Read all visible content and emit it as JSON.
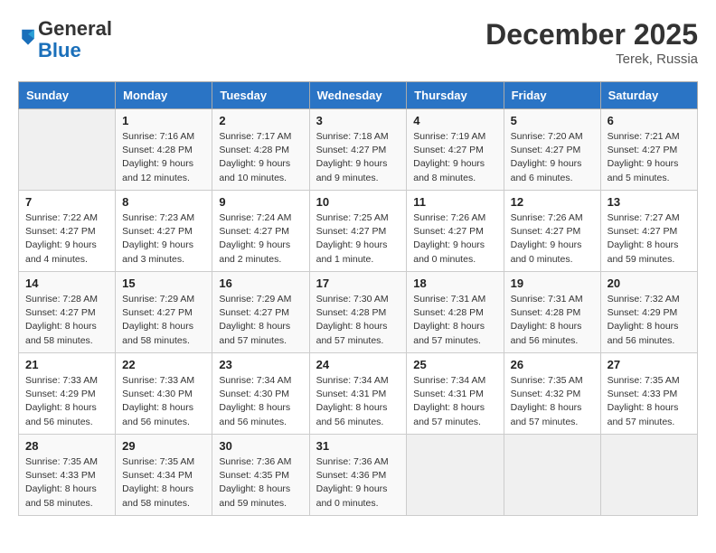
{
  "header": {
    "logo_general": "General",
    "logo_blue": "Blue",
    "month_title": "December 2025",
    "location": "Terek, Russia"
  },
  "days_of_week": [
    "Sunday",
    "Monday",
    "Tuesday",
    "Wednesday",
    "Thursday",
    "Friday",
    "Saturday"
  ],
  "weeks": [
    [
      {
        "day": "",
        "detail": ""
      },
      {
        "day": "1",
        "detail": "Sunrise: 7:16 AM\nSunset: 4:28 PM\nDaylight: 9 hours\nand 12 minutes."
      },
      {
        "day": "2",
        "detail": "Sunrise: 7:17 AM\nSunset: 4:28 PM\nDaylight: 9 hours\nand 10 minutes."
      },
      {
        "day": "3",
        "detail": "Sunrise: 7:18 AM\nSunset: 4:27 PM\nDaylight: 9 hours\nand 9 minutes."
      },
      {
        "day": "4",
        "detail": "Sunrise: 7:19 AM\nSunset: 4:27 PM\nDaylight: 9 hours\nand 8 minutes."
      },
      {
        "day": "5",
        "detail": "Sunrise: 7:20 AM\nSunset: 4:27 PM\nDaylight: 9 hours\nand 6 minutes."
      },
      {
        "day": "6",
        "detail": "Sunrise: 7:21 AM\nSunset: 4:27 PM\nDaylight: 9 hours\nand 5 minutes."
      }
    ],
    [
      {
        "day": "7",
        "detail": "Sunrise: 7:22 AM\nSunset: 4:27 PM\nDaylight: 9 hours\nand 4 minutes."
      },
      {
        "day": "8",
        "detail": "Sunrise: 7:23 AM\nSunset: 4:27 PM\nDaylight: 9 hours\nand 3 minutes."
      },
      {
        "day": "9",
        "detail": "Sunrise: 7:24 AM\nSunset: 4:27 PM\nDaylight: 9 hours\nand 2 minutes."
      },
      {
        "day": "10",
        "detail": "Sunrise: 7:25 AM\nSunset: 4:27 PM\nDaylight: 9 hours\nand 1 minute."
      },
      {
        "day": "11",
        "detail": "Sunrise: 7:26 AM\nSunset: 4:27 PM\nDaylight: 9 hours\nand 0 minutes."
      },
      {
        "day": "12",
        "detail": "Sunrise: 7:26 AM\nSunset: 4:27 PM\nDaylight: 9 hours\nand 0 minutes."
      },
      {
        "day": "13",
        "detail": "Sunrise: 7:27 AM\nSunset: 4:27 PM\nDaylight: 8 hours\nand 59 minutes."
      }
    ],
    [
      {
        "day": "14",
        "detail": "Sunrise: 7:28 AM\nSunset: 4:27 PM\nDaylight: 8 hours\nand 58 minutes."
      },
      {
        "day": "15",
        "detail": "Sunrise: 7:29 AM\nSunset: 4:27 PM\nDaylight: 8 hours\nand 58 minutes."
      },
      {
        "day": "16",
        "detail": "Sunrise: 7:29 AM\nSunset: 4:27 PM\nDaylight: 8 hours\nand 57 minutes."
      },
      {
        "day": "17",
        "detail": "Sunrise: 7:30 AM\nSunset: 4:28 PM\nDaylight: 8 hours\nand 57 minutes."
      },
      {
        "day": "18",
        "detail": "Sunrise: 7:31 AM\nSunset: 4:28 PM\nDaylight: 8 hours\nand 57 minutes."
      },
      {
        "day": "19",
        "detail": "Sunrise: 7:31 AM\nSunset: 4:28 PM\nDaylight: 8 hours\nand 56 minutes."
      },
      {
        "day": "20",
        "detail": "Sunrise: 7:32 AM\nSunset: 4:29 PM\nDaylight: 8 hours\nand 56 minutes."
      }
    ],
    [
      {
        "day": "21",
        "detail": "Sunrise: 7:33 AM\nSunset: 4:29 PM\nDaylight: 8 hours\nand 56 minutes."
      },
      {
        "day": "22",
        "detail": "Sunrise: 7:33 AM\nSunset: 4:30 PM\nDaylight: 8 hours\nand 56 minutes."
      },
      {
        "day": "23",
        "detail": "Sunrise: 7:34 AM\nSunset: 4:30 PM\nDaylight: 8 hours\nand 56 minutes."
      },
      {
        "day": "24",
        "detail": "Sunrise: 7:34 AM\nSunset: 4:31 PM\nDaylight: 8 hours\nand 56 minutes."
      },
      {
        "day": "25",
        "detail": "Sunrise: 7:34 AM\nSunset: 4:31 PM\nDaylight: 8 hours\nand 57 minutes."
      },
      {
        "day": "26",
        "detail": "Sunrise: 7:35 AM\nSunset: 4:32 PM\nDaylight: 8 hours\nand 57 minutes."
      },
      {
        "day": "27",
        "detail": "Sunrise: 7:35 AM\nSunset: 4:33 PM\nDaylight: 8 hours\nand 57 minutes."
      }
    ],
    [
      {
        "day": "28",
        "detail": "Sunrise: 7:35 AM\nSunset: 4:33 PM\nDaylight: 8 hours\nand 58 minutes."
      },
      {
        "day": "29",
        "detail": "Sunrise: 7:35 AM\nSunset: 4:34 PM\nDaylight: 8 hours\nand 58 minutes."
      },
      {
        "day": "30",
        "detail": "Sunrise: 7:36 AM\nSunset: 4:35 PM\nDaylight: 8 hours\nand 59 minutes."
      },
      {
        "day": "31",
        "detail": "Sunrise: 7:36 AM\nSunset: 4:36 PM\nDaylight: 9 hours\nand 0 minutes."
      },
      {
        "day": "",
        "detail": ""
      },
      {
        "day": "",
        "detail": ""
      },
      {
        "day": "",
        "detail": ""
      }
    ]
  ]
}
